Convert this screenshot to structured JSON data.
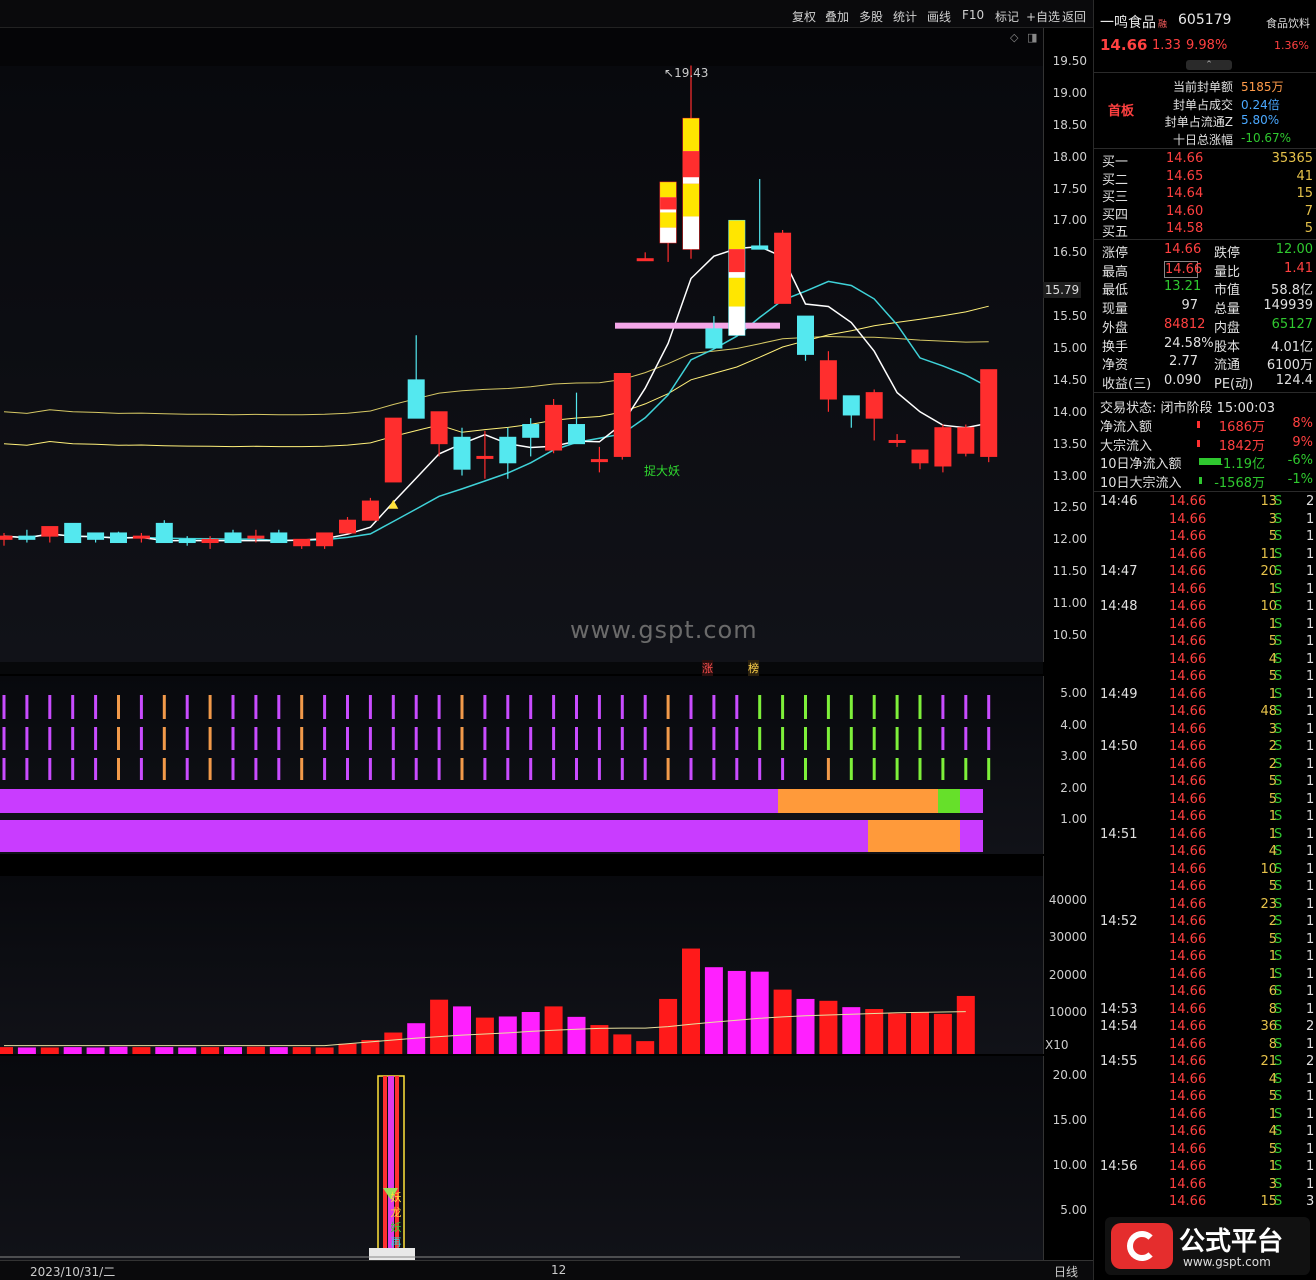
{
  "toolbar": {
    "items": [
      "复权",
      "叠加",
      "多股",
      "统计",
      "画线",
      "F10",
      "标记",
      "+自选",
      "返回"
    ]
  },
  "stock": {
    "name": "一鸣食品",
    "flag": "融",
    "code": "605179",
    "sector": "食品饮料",
    "price": "14.66",
    "change": "1.33",
    "pct": "9.98%",
    "sector_pct": "1.36%",
    "badge": "首板"
  },
  "seal": [
    {
      "label": "当前封单额",
      "value": "5185万"
    },
    {
      "label": "封单占成交",
      "value": "0.24倍"
    },
    {
      "label": "封单占流通Z",
      "value": "5.80%"
    },
    {
      "label": "十日总涨幅",
      "value": "-10.67%"
    }
  ],
  "book": [
    {
      "label": "买一",
      "price": "14.66",
      "vol": "35365"
    },
    {
      "label": "买二",
      "price": "14.65",
      "vol": "41"
    },
    {
      "label": "买三",
      "price": "14.64",
      "vol": "15"
    },
    {
      "label": "买四",
      "price": "14.60",
      "vol": "7"
    },
    {
      "label": "买五",
      "price": "14.58",
      "vol": "5"
    }
  ],
  "stats": [
    {
      "l1": "涨停",
      "v1": "14.66",
      "l2": "跌停",
      "v2": "12.00"
    },
    {
      "l1": "最高",
      "v1": "14.66",
      "l2": "量比",
      "v2": "1.41"
    },
    {
      "l1": "最低",
      "v1": "13.21",
      "l2": "市值",
      "v2": "58.8亿"
    },
    {
      "l1": "现量",
      "v1": "97",
      "l2": "总量",
      "v2": "149939"
    },
    {
      "l1": "外盘",
      "v1": "84812",
      "l2": "内盘",
      "v2": "65127"
    },
    {
      "l1": "换手",
      "v1": "24.58%",
      "l2": "股本",
      "v2": "4.01亿"
    },
    {
      "l1": "净资",
      "v1": "2.77",
      "l2": "流通",
      "v2": "6100万"
    },
    {
      "l1": "收益(三)",
      "v1": "0.090",
      "l2": "PE(动)",
      "v2": "124.4"
    }
  ],
  "trade_status": "交易状态: 闭市阶段 15:00:03",
  "flows": [
    {
      "label": "净流入额",
      "value": "1686万",
      "pct": "8%"
    },
    {
      "label": "大宗流入",
      "value": "1842万",
      "pct": "9%"
    },
    {
      "label": "10日净流入额",
      "value": "-1.19亿",
      "pct": "-6%"
    },
    {
      "label": "10日大宗流入",
      "value": "-1568万",
      "pct": "-1%"
    }
  ],
  "ticks": [
    {
      "t": "14:46",
      "p": "14.66",
      "v": "13",
      "s": "S",
      "n": "2"
    },
    {
      "t": "",
      "p": "14.66",
      "v": "3",
      "s": "S",
      "n": "1"
    },
    {
      "t": "",
      "p": "14.66",
      "v": "5",
      "s": "S",
      "n": "1"
    },
    {
      "t": "",
      "p": "14.66",
      "v": "11",
      "s": "S",
      "n": "1"
    },
    {
      "t": "14:47",
      "p": "14.66",
      "v": "20",
      "s": "S",
      "n": "1"
    },
    {
      "t": "",
      "p": "14.66",
      "v": "1",
      "s": "S",
      "n": "1"
    },
    {
      "t": "14:48",
      "p": "14.66",
      "v": "10",
      "s": "S",
      "n": "1"
    },
    {
      "t": "",
      "p": "14.66",
      "v": "1",
      "s": "S",
      "n": "1"
    },
    {
      "t": "",
      "p": "14.66",
      "v": "5",
      "s": "S",
      "n": "1"
    },
    {
      "t": "",
      "p": "14.66",
      "v": "4",
      "s": "S",
      "n": "1"
    },
    {
      "t": "",
      "p": "14.66",
      "v": "5",
      "s": "S",
      "n": "1"
    },
    {
      "t": "14:49",
      "p": "14.66",
      "v": "1",
      "s": "S",
      "n": "1"
    },
    {
      "t": "",
      "p": "14.66",
      "v": "48",
      "s": "S",
      "n": "1"
    },
    {
      "t": "",
      "p": "14.66",
      "v": "3",
      "s": "S",
      "n": "1"
    },
    {
      "t": "14:50",
      "p": "14.66",
      "v": "2",
      "s": "S",
      "n": "1"
    },
    {
      "t": "",
      "p": "14.66",
      "v": "2",
      "s": "S",
      "n": "1"
    },
    {
      "t": "",
      "p": "14.66",
      "v": "5",
      "s": "S",
      "n": "1"
    },
    {
      "t": "",
      "p": "14.66",
      "v": "5",
      "s": "S",
      "n": "1"
    },
    {
      "t": "",
      "p": "14.66",
      "v": "1",
      "s": "S",
      "n": "1"
    },
    {
      "t": "14:51",
      "p": "14.66",
      "v": "1",
      "s": "S",
      "n": "1"
    },
    {
      "t": "",
      "p": "14.66",
      "v": "4",
      "s": "S",
      "n": "1"
    },
    {
      "t": "",
      "p": "14.66",
      "v": "10",
      "s": "S",
      "n": "1"
    },
    {
      "t": "",
      "p": "14.66",
      "v": "5",
      "s": "S",
      "n": "1"
    },
    {
      "t": "",
      "p": "14.66",
      "v": "23",
      "s": "S",
      "n": "1"
    },
    {
      "t": "14:52",
      "p": "14.66",
      "v": "2",
      "s": "S",
      "n": "1"
    },
    {
      "t": "",
      "p": "14.66",
      "v": "5",
      "s": "S",
      "n": "1"
    },
    {
      "t": "",
      "p": "14.66",
      "v": "1",
      "s": "S",
      "n": "1"
    },
    {
      "t": "",
      "p": "14.66",
      "v": "1",
      "s": "S",
      "n": "1"
    },
    {
      "t": "",
      "p": "14.66",
      "v": "6",
      "s": "S",
      "n": "1"
    },
    {
      "t": "14:53",
      "p": "14.66",
      "v": "8",
      "s": "S",
      "n": "1"
    },
    {
      "t": "14:54",
      "p": "14.66",
      "v": "36",
      "s": "S",
      "n": "2"
    },
    {
      "t": "",
      "p": "14.66",
      "v": "8",
      "s": "S",
      "n": "1"
    },
    {
      "t": "14:55",
      "p": "14.66",
      "v": "21",
      "s": "S",
      "n": "2"
    },
    {
      "t": "",
      "p": "14.66",
      "v": "4",
      "s": "S",
      "n": "1"
    },
    {
      "t": "",
      "p": "14.66",
      "v": "5",
      "s": "S",
      "n": "1"
    },
    {
      "t": "",
      "p": "14.66",
      "v": "1",
      "s": "S",
      "n": "1"
    },
    {
      "t": "",
      "p": "14.66",
      "v": "4",
      "s": "S",
      "n": "1"
    },
    {
      "t": "",
      "p": "14.66",
      "v": "5",
      "s": "S",
      "n": "1"
    },
    {
      "t": "14:56",
      "p": "14.66",
      "v": "1",
      "s": "S",
      "n": "1"
    },
    {
      "t": "",
      "p": "14.66",
      "v": "3",
      "s": "S",
      "n": "1"
    },
    {
      "t": "",
      "p": "14.66",
      "v": "15",
      "s": "S",
      "n": "3"
    }
  ],
  "chart": {
    "price_ticks": [
      "19.50",
      "19.00",
      "18.50",
      "18.00",
      "17.50",
      "17.00",
      "16.50",
      "15.50",
      "15.00",
      "14.50",
      "14.00",
      "13.50",
      "13.00",
      "12.50",
      "12.00",
      "11.50",
      "11.00",
      "10.50"
    ],
    "current_label": "15.79",
    "high_label": "19.43",
    "annotation": "捉大妖",
    "markers": [
      "涨",
      "榜"
    ],
    "ind_ticks": [
      "5.00",
      "4.00",
      "3.00",
      "2.00",
      "1.00"
    ],
    "vol_ticks": [
      "40000",
      "30000",
      "20000",
      "10000"
    ],
    "vol_unit": "X10",
    "low_ticks": [
      "20.00",
      "15.00",
      "10.00",
      "5.00"
    ],
    "low_chars": [
      "妖",
      "龙",
      "妖",
      "再"
    ],
    "date_left": "2023/10/31/二",
    "date_mid": "12",
    "period": "日线",
    "watermark": "www.gspt.com",
    "logo_text": "公式平台",
    "logo_url": "www.gspt.com"
  },
  "chart_data": {
    "type": "candlestick",
    "ylim": [
      10.3,
      19.7
    ],
    "candles": [
      {
        "o": 12.0,
        "h": 12.1,
        "l": 11.9,
        "c": 12.05
      },
      {
        "o": 12.05,
        "h": 12.15,
        "l": 11.95,
        "c": 12.0
      },
      {
        "o": 12.05,
        "h": 12.2,
        "l": 11.95,
        "c": 12.2
      },
      {
        "o": 12.25,
        "h": 12.25,
        "l": 11.95,
        "c": 11.95
      },
      {
        "o": 12.1,
        "h": 12.1,
        "l": 11.95,
        "c": 12.0
      },
      {
        "o": 12.1,
        "h": 12.12,
        "l": 11.95,
        "c": 11.95
      },
      {
        "o": 12.05,
        "h": 12.1,
        "l": 11.95,
        "c": 12.05
      },
      {
        "o": 12.25,
        "h": 12.3,
        "l": 11.95,
        "c": 11.95
      },
      {
        "o": 12.0,
        "h": 12.05,
        "l": 11.9,
        "c": 11.95
      },
      {
        "o": 11.95,
        "h": 12.05,
        "l": 11.85,
        "c": 12.0
      },
      {
        "o": 12.1,
        "h": 12.15,
        "l": 11.95,
        "c": 11.95
      },
      {
        "o": 12.05,
        "h": 12.15,
        "l": 11.95,
        "c": 12.05
      },
      {
        "o": 12.1,
        "h": 12.15,
        "l": 12.0,
        "c": 11.95
      },
      {
        "o": 11.9,
        "h": 12.0,
        "l": 11.85,
        "c": 12.0
      },
      {
        "o": 11.9,
        "h": 12.1,
        "l": 11.85,
        "c": 12.1
      },
      {
        "o": 12.1,
        "h": 12.35,
        "l": 12.1,
        "c": 12.3
      },
      {
        "o": 12.3,
        "h": 12.65,
        "l": 12.3,
        "c": 12.6
      },
      {
        "o": 12.9,
        "h": 13.9,
        "l": 12.9,
        "c": 13.9
      },
      {
        "o": 14.5,
        "h": 15.2,
        "l": 13.9,
        "c": 13.9
      },
      {
        "o": 13.5,
        "h": 14.0,
        "l": 13.3,
        "c": 14.0
      },
      {
        "o": 13.6,
        "h": 13.75,
        "l": 13.0,
        "c": 13.1
      },
      {
        "o": 13.3,
        "h": 13.7,
        "l": 12.95,
        "c": 13.3
      },
      {
        "o": 13.6,
        "h": 13.75,
        "l": 12.95,
        "c": 13.2
      },
      {
        "o": 13.8,
        "h": 13.9,
        "l": 13.3,
        "c": 13.6
      },
      {
        "o": 13.4,
        "h": 14.2,
        "l": 13.35,
        "c": 14.1
      },
      {
        "o": 13.8,
        "h": 14.3,
        "l": 13.5,
        "c": 13.5
      },
      {
        "o": 13.25,
        "h": 13.45,
        "l": 13.05,
        "c": 13.25
      },
      {
        "o": 13.3,
        "h": 14.6,
        "l": 13.25,
        "c": 14.6
      },
      {
        "o": 16.4,
        "h": 16.5,
        "l": 16.4,
        "c": 16.4
      },
      {
        "o": 16.65,
        "h": 17.6,
        "l": 16.35,
        "c": 17.6
      },
      {
        "o": 16.55,
        "h": 19.43,
        "l": 16.4,
        "c": 18.6
      },
      {
        "o": 15.3,
        "h": 15.5,
        "l": 15.0,
        "c": 15.0
      },
      {
        "o": 17.0,
        "h": 17.0,
        "l": 15.2,
        "c": 15.2
      },
      {
        "o": 16.6,
        "h": 17.65,
        "l": 16.55,
        "c": 16.55
      },
      {
        "o": 15.7,
        "h": 16.85,
        "l": 15.7,
        "c": 16.8
      },
      {
        "o": 15.5,
        "h": 15.5,
        "l": 14.8,
        "c": 14.9
      },
      {
        "o": 14.2,
        "h": 14.95,
        "l": 14.0,
        "c": 14.8
      },
      {
        "o": 14.25,
        "h": 14.2,
        "l": 13.75,
        "c": 13.95
      },
      {
        "o": 13.9,
        "h": 14.35,
        "l": 13.55,
        "c": 14.3
      },
      {
        "o": 13.55,
        "h": 13.65,
        "l": 13.45,
        "c": 13.55
      },
      {
        "o": 13.2,
        "h": 13.4,
        "l": 13.1,
        "c": 13.4
      },
      {
        "o": 13.15,
        "h": 13.8,
        "l": 13.05,
        "c": 13.75
      },
      {
        "o": 13.35,
        "h": 13.8,
        "l": 13.3,
        "c": 13.75
      },
      {
        "o": 13.3,
        "h": 14.66,
        "l": 13.21,
        "c": 14.66
      }
    ],
    "volume": [
      600,
      500,
      500,
      600,
      500,
      700,
      600,
      600,
      500,
      600,
      600,
      700,
      600,
      600,
      500,
      1500,
      2500,
      4500,
      7000,
      13300,
      11500,
      8500,
      8800,
      10000,
      11500,
      8700,
      6500,
      4000,
      2200,
      13500,
      27000,
      22000,
      21000,
      20800,
      16000,
      13500,
      13000,
      11300,
      10800,
      9600,
      9900,
      9500,
      14300
    ],
    "volume_ma": [
      1000,
      1000,
      1000,
      1000,
      1000,
      1000,
      1000,
      1000,
      1000,
      1000,
      1000,
      1000,
      1000,
      1000,
      1000,
      1500,
      2000,
      2500,
      3000,
      3400,
      3800,
      4100,
      4400,
      4800,
      5100,
      5400,
      5600,
      5700,
      5700,
      6100,
      6700,
      7300,
      7800,
      8300,
      8700,
      9000,
      9200,
      9400,
      9600,
      9800,
      9900,
      10000,
      10100
    ]
  },
  "colors": {
    "up": "#ff2e2e",
    "down": "#54e8ef",
    "volume_up": "#ff1a1a",
    "volume_down": "#ff20ff",
    "ma5": "#ffffff",
    "ma10": "#fff07a",
    "ma20": "#3fd2d8",
    "ma60": "#d6c865"
  }
}
